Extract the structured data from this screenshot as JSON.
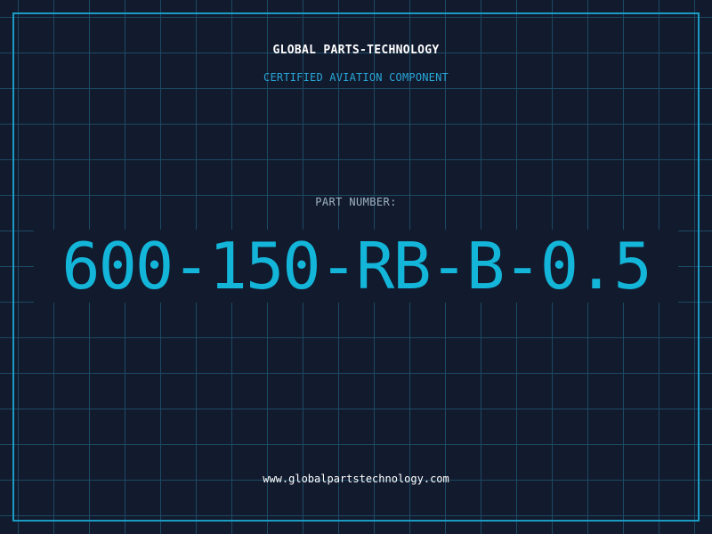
{
  "header": {
    "company": "GLOBAL PARTS-TECHNOLOGY",
    "subtitle": "CERTIFIED AVIATION COMPONENT"
  },
  "part": {
    "label": "PART NUMBER:",
    "number": "600-150-RB-B-0.5"
  },
  "footer": {
    "url": "www.globalpartstechnology.com"
  },
  "colors": {
    "background": "#121a2e",
    "grid": "#1c4a63",
    "frame": "#1a9cc2",
    "accent": "#13b6d9"
  }
}
